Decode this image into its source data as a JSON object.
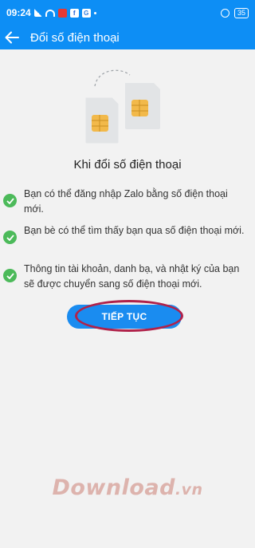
{
  "status_bar": {
    "time": "09:24",
    "battery": "35"
  },
  "header": {
    "title": "Đổi số điện thoại"
  },
  "content": {
    "heading": "Khi đổi số điện thoại",
    "items": [
      {
        "text": "Bạn có thể đăng nhập Zalo bằng số điện thoại mới."
      },
      {
        "text": "Bạn bè có thể tìm thấy bạn qua số điện thoại mới."
      },
      {
        "text": "Thông tin tài khoản, danh bạ, và nhật ký của bạn sẽ được chuyển sang số điện thoại mới."
      }
    ]
  },
  "continue_button": {
    "label": "TIẾP TỤC"
  },
  "watermark": {
    "main": "Download",
    "suffix": ".vn"
  },
  "colors": {
    "primary": "#0d8ef5",
    "button": "#1a8cf0",
    "check": "#4cba5a",
    "highlight": "#b0224a",
    "sim_chip": "#f2b94a"
  },
  "icons": {
    "back": "arrow-left-icon",
    "check": "check-circle-icon",
    "sim": "sim-card-icon"
  }
}
